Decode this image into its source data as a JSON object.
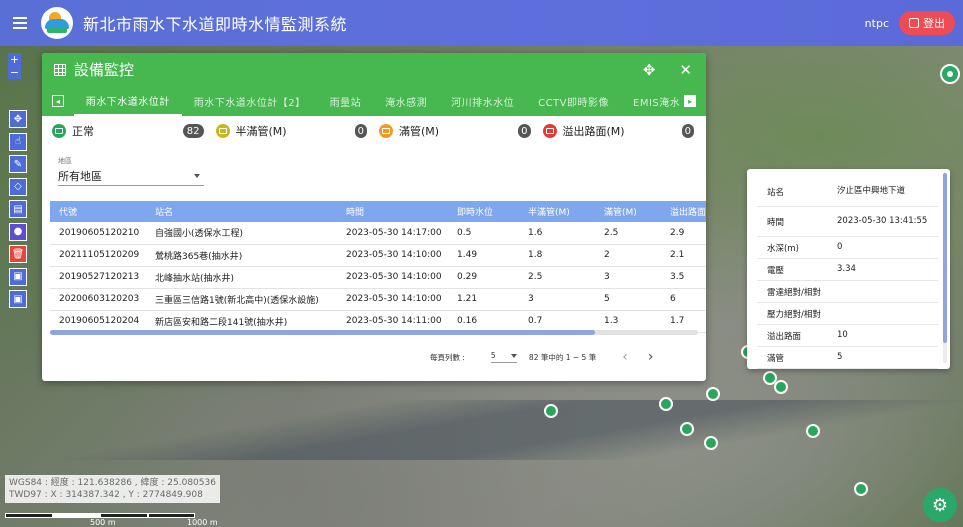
{
  "header": {
    "title": "新北市雨水下水道即時水情監測系統",
    "user": "ntpc",
    "logout_label": "登出",
    "bg_color": "#5a6fd6"
  },
  "map_tools": {
    "zoom_in": "+",
    "zoom_out": "−",
    "tools": [
      "move-icon",
      "hand-icon",
      "pencil-icon",
      "eraser-icon",
      "ruler-icon",
      "location-pin-icon",
      "trash-icon",
      "document-icon",
      "document-icon"
    ]
  },
  "coordinates": {
    "line1": "WGS84 : 經度 : 121.638286 , 緯度 : 25.080536",
    "line2": "TWD97 : X : 314387.342 , Y : 2774849.908"
  },
  "scale": {
    "mid": "500 m",
    "end": "1000 m"
  },
  "panel": {
    "title": "設備監控",
    "accent": "#46b84f",
    "tabs": [
      {
        "label": "雨水下水道水位計",
        "active": true
      },
      {
        "label": "雨水下水道水位計【2】",
        "active": false
      },
      {
        "label": "雨量站",
        "active": false
      },
      {
        "label": "淹水感測",
        "active": false
      },
      {
        "label": "河川排水水位",
        "active": false
      },
      {
        "label": "CCTV即時影像",
        "active": false
      },
      {
        "label": "EMIS淹水",
        "active": false
      }
    ],
    "statuses": [
      {
        "label": "正常",
        "count": "82",
        "color": "#2aa65c"
      },
      {
        "label": "半滿管(M)",
        "count": "0",
        "color": "#c7b91d"
      },
      {
        "label": "滿管(M)",
        "count": "0",
        "color": "#f29a25"
      },
      {
        "label": "溢出路面(M)",
        "count": "0",
        "color": "#e53935"
      }
    ],
    "region": {
      "label": "地區",
      "value": "所有地區"
    },
    "table": {
      "headers": [
        "代號",
        "站名",
        "時間",
        "即時水位",
        "半滿管(M)",
        "滿管(M)",
        "溢出路面(M)"
      ],
      "rows": [
        [
          "20190605120210",
          "自強國小(透保水工程)",
          "2023-05-30 14:17:00",
          "0.5",
          "1.6",
          "2.5",
          "2.9"
        ],
        [
          "20211105120209",
          "鶯桃路365巷(抽水井)",
          "2023-05-30 14:10:00",
          "1.49",
          "1.8",
          "2",
          "2.1"
        ],
        [
          "20190527120213",
          "北峰抽水站(抽水井)",
          "2023-05-30 14:10:00",
          "0.29",
          "2.5",
          "3",
          "3.5"
        ],
        [
          "20200603120203",
          "三重區三信路1號(新北高中)(透保水設施)",
          "2023-05-30 14:10:00",
          "1.21",
          "3",
          "5",
          "6"
        ],
        [
          "20190605120204",
          "新店區安和路二段141號(抽水井)",
          "2023-05-30 14:11:00",
          "0.16",
          "0.7",
          "1.3",
          "1.7"
        ]
      ]
    },
    "pager": {
      "rows_per_page_label": "每頁列數 :",
      "rows_per_page": "5",
      "range": "82 筆中的 1 ~ 5 筆",
      "prev": "‹",
      "next": "›"
    }
  },
  "info": {
    "rows": [
      {
        "k": "站名",
        "v": "汐止區中興地下道"
      },
      {
        "k": "時間",
        "v": "2023-05-30 13:41:55"
      },
      {
        "k": "水深(m)",
        "v": "0"
      },
      {
        "k": "電壓",
        "v": "3.34"
      },
      {
        "k": "雷達絕對/相對",
        "v": ""
      },
      {
        "k": "壓力絕對/相對",
        "v": ""
      },
      {
        "k": "溢出路面",
        "v": "10"
      },
      {
        "k": "滿管",
        "v": "5"
      }
    ]
  }
}
